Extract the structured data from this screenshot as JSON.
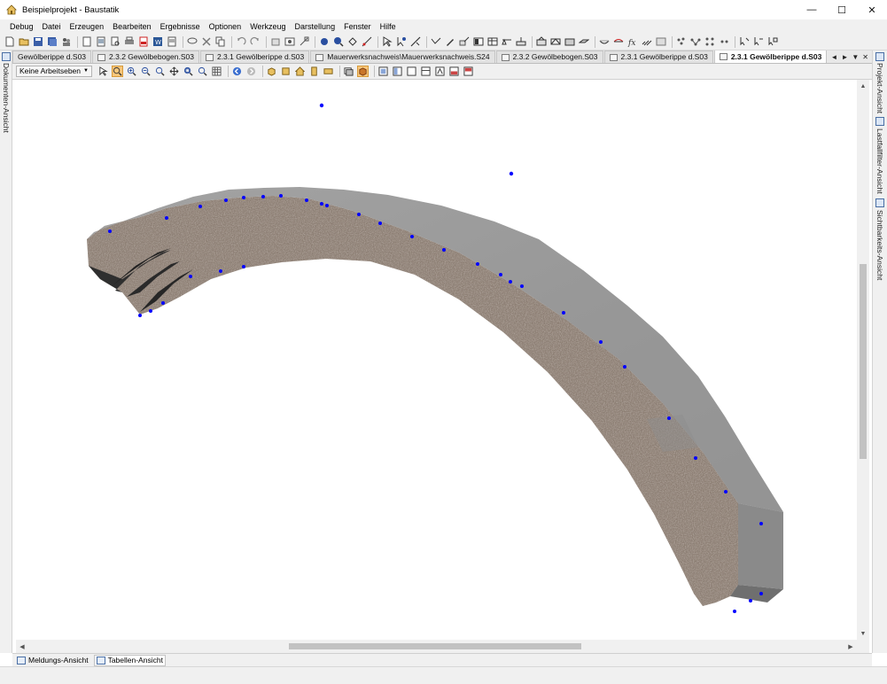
{
  "window": {
    "title": "Beispielprojekt - Baustatik",
    "icon": "house-app-icon",
    "controls": [
      "minimize-icon",
      "maximize-icon",
      "close-icon"
    ]
  },
  "menu": [
    "Debug",
    "Datei",
    "Erzeugen",
    "Bearbeiten",
    "Ergebnisse",
    "Optionen",
    "Werkzeug",
    "Darstellung",
    "Fenster",
    "Hilfe"
  ],
  "doc_tabs": [
    {
      "label": "Gewölberippe d.S03",
      "active": false
    },
    {
      "label": "2.3.2  Gewölbebogen.S03",
      "active": false
    },
    {
      "label": "2.3.1  Gewölberippe d.S03",
      "active": false
    },
    {
      "label": "Mauerwerksnachweis\\Mauerwerksnachweis.S24",
      "active": false
    },
    {
      "label": "2.3.2  Gewölbebogen.S03",
      "active": false
    },
    {
      "label": "2.3.1  Gewölberippe d.S03",
      "active": false
    },
    {
      "label": "2.3.1  Gewölberippe d.S03",
      "active": true
    }
  ],
  "doc_tab_controls": [
    "◄",
    "►",
    "▼",
    "✕"
  ],
  "view_toolbar": {
    "working_plane": "Keine Arbeitseben"
  },
  "side_panels": {
    "left": "Dokumenten-Ansicht",
    "right": [
      "Projekt-Ansicht",
      "Lastfallfilter-Ansicht",
      "Sichtbarkeits-Ansicht"
    ]
  },
  "bottom_tabs": [
    {
      "label": "Meldungs-Ansicht",
      "active": false
    },
    {
      "label": "Tabellen-Ansicht",
      "active": true
    }
  ],
  "model_view": {
    "description_colors": {
      "top_face": "#9a9a9a",
      "end_face": "#8a8a8a",
      "texture_base": "#8b7d72",
      "node_point": "#0000ff"
    }
  }
}
